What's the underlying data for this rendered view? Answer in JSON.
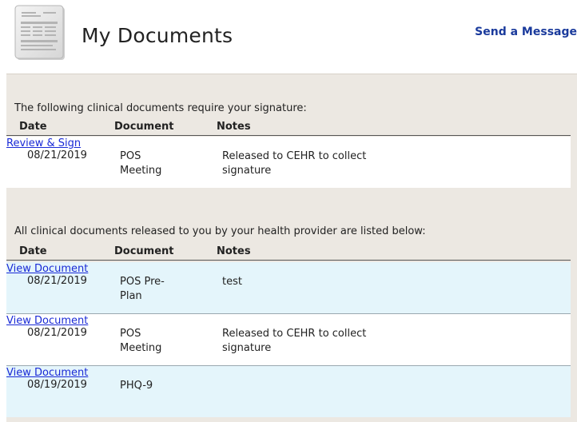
{
  "header": {
    "title": "My Documents",
    "send_message": "Send a Message"
  },
  "pending": {
    "intro": "The following clinical documents require your signature:",
    "columns": [
      "Date",
      "Document",
      "Notes"
    ],
    "rows": [
      {
        "date": "08/21/2019",
        "document": "POS Meeting",
        "notes": "Released to CEHR to collect signature",
        "action": "Review & Sign"
      }
    ]
  },
  "released": {
    "intro": "All clinical documents released to you by your health provider are listed below:",
    "columns": [
      "Date",
      "Document",
      "Notes"
    ],
    "rows": [
      {
        "date": "08/21/2019",
        "document": "POS Pre-Plan",
        "notes": "test",
        "action": "View Document"
      },
      {
        "date": "08/21/2019",
        "document": "POS Meeting",
        "notes": "Released to CEHR to collect signature",
        "action": "View Document"
      },
      {
        "date": "08/19/2019",
        "document": "PHQ-9",
        "notes": "",
        "action": "View Document"
      }
    ]
  },
  "colors": {
    "panel_bg": "#ece8e2",
    "row_highlight": "#e4f5fb",
    "link": "#1a2ad6",
    "header_link": "#1a3a9c"
  },
  "icons": {
    "page_icon": "document-icon"
  }
}
